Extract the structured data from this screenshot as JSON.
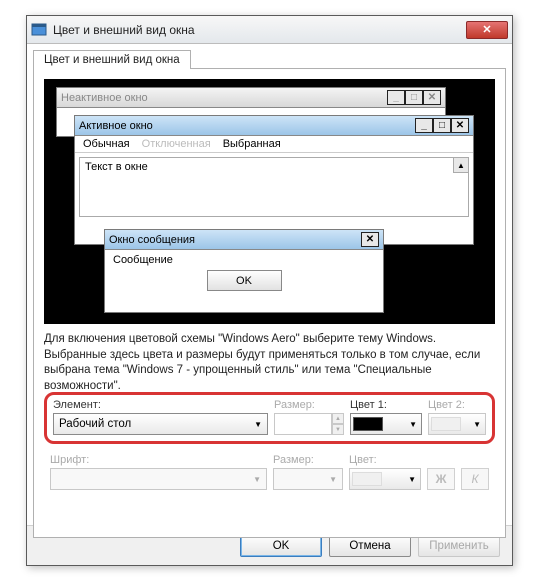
{
  "window": {
    "title": "Цвет и внешний вид окна",
    "close_glyph": "✕"
  },
  "tab": {
    "label": "Цвет и внешний вид окна"
  },
  "preview": {
    "inactive_title": "Неактивное окно",
    "active_title": "Активное окно",
    "menu_normal": "Обычная",
    "menu_disabled": "Отключенная",
    "menu_selected": "Выбранная",
    "text_in_window": "Текст в окне",
    "msgbox_title": "Окно сообщения",
    "msgbox_text": "Сообщение",
    "msgbox_ok": "OK",
    "btn_min": "_",
    "btn_max": "□",
    "btn_close": "✕",
    "scroll_up": "▲"
  },
  "description": "Для включения цветовой схемы \"Windows Aero\" выберите тему Windows. Выбранные здесь цвета и размеры будут применяться только в том случае, если выбрана тема \"Windows 7 - упрощенный стиль\" или тема \"Специальные возможности\".",
  "element_row": {
    "element_label": "Элемент:",
    "element_value": "Рабочий стол",
    "size_label": "Размер:",
    "color1_label": "Цвет 1:",
    "color2_label": "Цвет 2:",
    "color1_value": "#000000"
  },
  "font_row": {
    "font_label": "Шрифт:",
    "size_label": "Размер:",
    "color_label": "Цвет:",
    "bold_glyph": "Ж",
    "italic_glyph": "К"
  },
  "footer": {
    "ok": "OK",
    "cancel": "Отмена",
    "apply": "Применить"
  },
  "glyphs": {
    "caret": "▼"
  }
}
